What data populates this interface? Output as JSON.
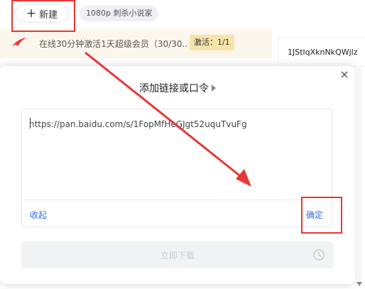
{
  "toolbar": {
    "new_label": "新建",
    "new_icon": "plus-icon",
    "search_chip": "1080p 刺杀小说家"
  },
  "promo": {
    "text": "在线30分钟激活1天超级会员（30/30...",
    "badge": "激活：1/1",
    "logo_icon": "brand-logo-icon"
  },
  "background_item": {
    "text": "1JStlqXknNkQWjlz"
  },
  "dialog": {
    "title": "添加链接或口令",
    "link_value": "https://pan.baidu.com/s/1FopMfHeGJgt52uquTvuFg",
    "collapse_label": "收起",
    "confirm_label": "确定",
    "download_label": "立即下载",
    "close_icon": "close-icon",
    "clock_icon": "clock-icon"
  },
  "colors": {
    "accent": "#2d6ff2",
    "annotation": "#e53935",
    "promo_bg": "#fdf6ec",
    "badge_bg": "#f8e3a9"
  }
}
